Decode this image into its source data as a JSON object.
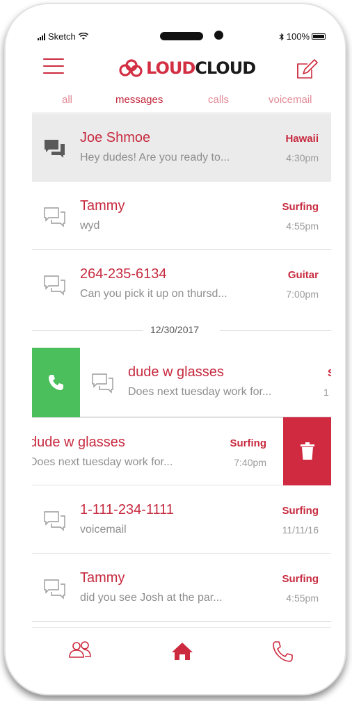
{
  "status_bar": {
    "carrier": "Sketch",
    "battery": "100%"
  },
  "header": {
    "logo_part1": "LOUD",
    "logo_part2": "CLOUD"
  },
  "tabs": [
    {
      "label": "all"
    },
    {
      "label": "messages"
    },
    {
      "label": "calls"
    },
    {
      "label": "voicemail"
    }
  ],
  "active_tab": "messages",
  "rows": [
    {
      "name": "Joe Shmoe",
      "preview": "Hey dudes! Are you ready to...",
      "tag": "Hawaii",
      "time": "4:30pm",
      "selected": true
    },
    {
      "name": "Tammy",
      "preview": "wyd",
      "tag": "Surfing",
      "time": "4:55pm"
    },
    {
      "name": "264-235-6134",
      "preview": "Can you pick it up on thursd...",
      "tag": "Guitar",
      "time": "7:00pm"
    }
  ],
  "date_separator": "12/30/2017",
  "swiped_right_row": {
    "name": "dude w glasses",
    "preview": "Does next tuesday work for...",
    "tag_partial": "S",
    "time_partial": "1"
  },
  "swiped_left_row": {
    "name": "dude w glasses",
    "preview": "Does next tuesday work for...",
    "tag": "Surfing",
    "time": "7:40pm"
  },
  "rows_after": [
    {
      "name": "1-111-234-1111",
      "preview": "voicemail",
      "tag": "Surfing",
      "time": "11/11/16"
    },
    {
      "name": "Tammy",
      "preview": "did you see Josh at the par...",
      "tag": "Surfing",
      "time": "4:55pm"
    }
  ],
  "icons": {
    "menu": "hamburger-icon",
    "compose": "compose-icon",
    "message": "chat-bubbles-icon",
    "call": "phone-icon",
    "delete": "trash-icon",
    "contacts": "people-icon",
    "home": "home-icon",
    "phone": "phone-outline-icon"
  },
  "colors": {
    "brand_red": "#c72a3f",
    "call_green": "#4bbf5b",
    "delete_red": "#cf2a40"
  }
}
